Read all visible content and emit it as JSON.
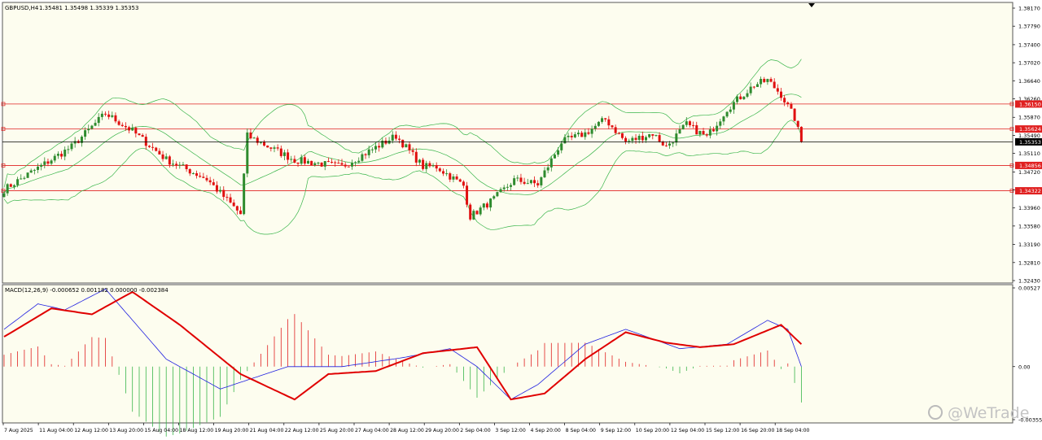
{
  "header": {
    "symbol_label": "GBPUSD,H4",
    "ohlc": "1.35481 1.35498 1.35339 1.35353",
    "macd_label": "MACD(12,26,9) -0.000652 0.001182 0.000000 -0.002384"
  },
  "watermark": {
    "text": "@WeTrade",
    "icon": "wetrade-logo-icon"
  },
  "colors": {
    "background": "#FDFDEF",
    "bull": "#2E8B2E",
    "bear": "#E01010",
    "bands": "#39B54A",
    "level": "#E02020",
    "current": "#000000",
    "macd_line": "#2020E0",
    "signal_line": "#E00000",
    "hist_pos": "#E02020",
    "hist_neg": "#39B54A"
  },
  "chart_data": [
    {
      "type": "candlestick",
      "title": "GBPUSD,H4",
      "ylim": [
        1.3243,
        1.3817
      ],
      "y_ticks": [
        "1.38170",
        "1.37790",
        "1.37400",
        "1.37020",
        "1.36640",
        "1.36260",
        "1.35870",
        "1.35490",
        "1.35110",
        "1.34720",
        "1.34340",
        "1.33960",
        "1.33580",
        "1.33190",
        "1.32810",
        "1.32430"
      ],
      "x_labels": [
        "7 Aug 2025",
        "11 Aug 04:00",
        "12 Aug 12:00",
        "13 Aug 20:00",
        "15 Aug 04:00",
        "18 Aug 12:00",
        "19 Aug 20:00",
        "21 Aug 04:00",
        "22 Aug 12:00",
        "25 Aug 20:00",
        "27 Aug 04:00",
        "28 Aug 12:00",
        "29 Aug 20:00",
        "2 Sep 04:00",
        "3 Sep 12:00",
        "4 Sep 20:00",
        "8 Sep 04:00",
        "9 Sep 12:00",
        "10 Sep 20:00",
        "12 Sep 04:00",
        "15 Sep 12:00",
        "16 Sep 20:00",
        "18 Sep 04:00"
      ],
      "horizontal_levels": [
        {
          "value": 1.3615,
          "label": "1.36150"
        },
        {
          "value": 1.35624,
          "label": "1.35624"
        },
        {
          "value": 1.34856,
          "label": "1.34856"
        },
        {
          "value": 1.34322,
          "label": "1.34322"
        }
      ],
      "current_price": {
        "value": 1.35353,
        "label": "1.35353"
      },
      "indicators": [
        "Bollinger Bands"
      ],
      "key_points": [
        {
          "i": 0,
          "close": 1.3435
        },
        {
          "i": 20,
          "close": 1.3525
        },
        {
          "i": 30,
          "close": 1.3595
        },
        {
          "i": 38,
          "close": 1.3558
        },
        {
          "i": 48,
          "close": 1.3498
        },
        {
          "i": 60,
          "close": 1.3457
        },
        {
          "i": 70,
          "close": 1.3383
        },
        {
          "i": 72,
          "close": 1.3548
        },
        {
          "i": 86,
          "close": 1.3497
        },
        {
          "i": 100,
          "close": 1.3483
        },
        {
          "i": 116,
          "close": 1.3548
        },
        {
          "i": 124,
          "close": 1.3483
        },
        {
          "i": 128,
          "close": 1.3483
        },
        {
          "i": 136,
          "close": 1.3443
        },
        {
          "i": 138,
          "close": 1.3378
        },
        {
          "i": 145,
          "close": 1.3415
        },
        {
          "i": 151,
          "close": 1.3455
        },
        {
          "i": 158,
          "close": 1.3446
        },
        {
          "i": 165,
          "close": 1.3535
        },
        {
          "i": 172,
          "close": 1.3553
        },
        {
          "i": 178,
          "close": 1.3583
        },
        {
          "i": 184,
          "close": 1.3535
        },
        {
          "i": 192,
          "close": 1.3553
        },
        {
          "i": 196,
          "close": 1.3525
        },
        {
          "i": 202,
          "close": 1.3572
        },
        {
          "i": 208,
          "close": 1.3545
        },
        {
          "i": 214,
          "close": 1.3605
        },
        {
          "i": 222,
          "close": 1.3655
        },
        {
          "i": 226,
          "close": 1.3665
        },
        {
          "i": 230,
          "close": 1.3635
        },
        {
          "i": 234,
          "close": 1.3585
        },
        {
          "i": 236,
          "close": 1.35353
        }
      ]
    },
    {
      "type": "macd",
      "title": "MACD(12,26,9)",
      "ylim": [
        -0.003553,
        0.00527
      ],
      "y_ticks": [
        "0.00527",
        "0.00",
        "-0.003553"
      ],
      "series": [
        {
          "name": "MACD",
          "key_points": [
            [
              0,
              0.0025
            ],
            [
              10,
              0.0042
            ],
            [
              18,
              0.0038
            ],
            [
              30,
              0.0052
            ],
            [
              48,
              0.0005
            ],
            [
              64,
              -0.0015
            ],
            [
              84,
              0.0
            ],
            [
              100,
              0.0
            ],
            [
              118,
              0.0006
            ],
            [
              132,
              0.0012
            ],
            [
              140,
              0.0
            ],
            [
              150,
              -0.0022
            ],
            [
              158,
              -0.0012
            ],
            [
              172,
              0.0015
            ],
            [
              184,
              0.0025
            ],
            [
              200,
              0.0012
            ],
            [
              214,
              0.0015
            ],
            [
              226,
              0.0031
            ],
            [
              232,
              0.0025
            ],
            [
              236,
              0.0
            ]
          ]
        },
        {
          "name": "Signal",
          "key_points": [
            [
              0,
              0.002
            ],
            [
              14,
              0.0039
            ],
            [
              26,
              0.0035
            ],
            [
              38,
              0.005
            ],
            [
              52,
              0.0028
            ],
            [
              70,
              -0.0005
            ],
            [
              86,
              -0.0022
            ],
            [
              96,
              -0.0005
            ],
            [
              110,
              -0.0003
            ],
            [
              124,
              0.0009
            ],
            [
              140,
              0.0013
            ],
            [
              150,
              -0.0022
            ],
            [
              160,
              -0.0018
            ],
            [
              172,
              0.0005
            ],
            [
              184,
              0.0023
            ],
            [
              196,
              0.0016
            ],
            [
              206,
              0.0013
            ],
            [
              216,
              0.0015
            ],
            [
              230,
              0.0028
            ],
            [
              236,
              0.0015
            ]
          ]
        }
      ]
    }
  ]
}
